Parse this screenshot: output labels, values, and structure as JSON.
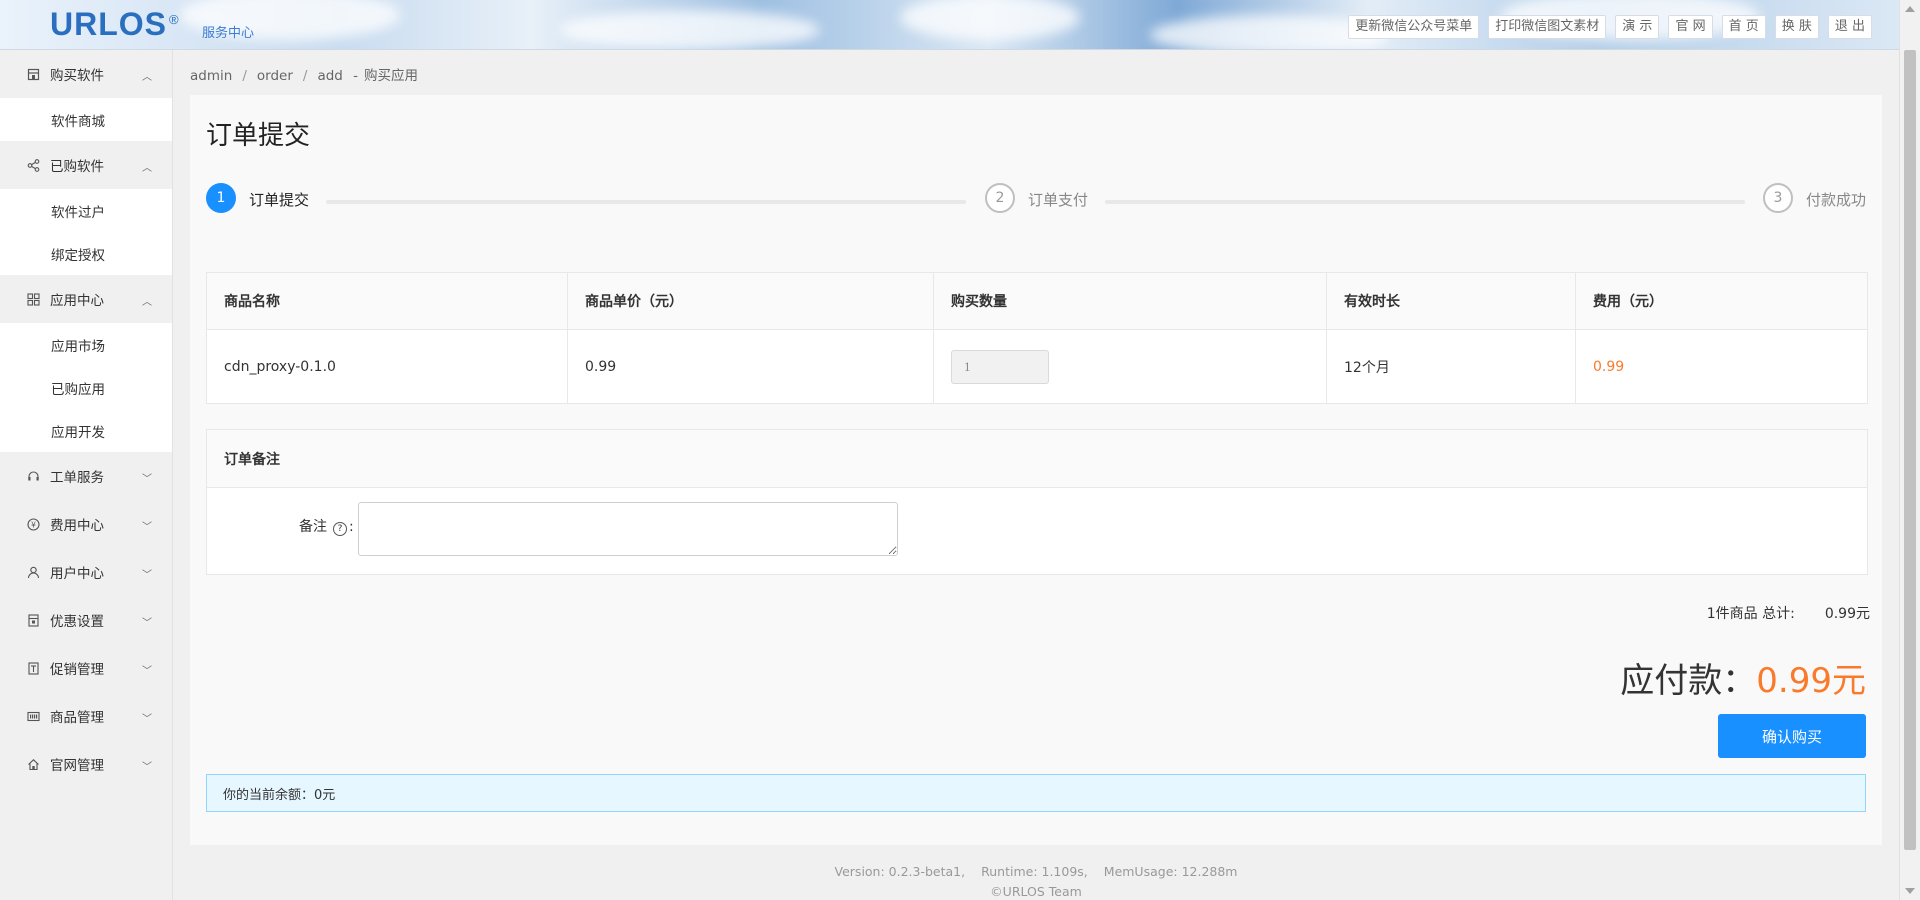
{
  "header": {
    "logo": "URLOS",
    "logo_mark": "®",
    "subtitle": "服务中心",
    "links": [
      "更新微信公众号菜单",
      "打印微信图文素材",
      "演 示",
      "官 网",
      "首 页",
      "换 肤",
      "退 出"
    ]
  },
  "sidebar": {
    "groups": [
      {
        "label": "购买软件",
        "icon": "shop-icon",
        "expanded": true,
        "items": [
          "软件商城"
        ]
      },
      {
        "label": "已购软件",
        "icon": "share-icon",
        "expanded": true,
        "items": [
          "软件过户",
          "绑定授权"
        ]
      },
      {
        "label": "应用中心",
        "icon": "grid-icon",
        "expanded": true,
        "items": [
          "应用市场",
          "已购应用",
          "应用开发"
        ]
      },
      {
        "label": "工单服务",
        "icon": "headset-icon",
        "expanded": false,
        "items": []
      },
      {
        "label": "费用中心",
        "icon": "yuan-icon",
        "expanded": false,
        "items": []
      },
      {
        "label": "用户中心",
        "icon": "user-icon",
        "expanded": false,
        "items": []
      },
      {
        "label": "优惠设置",
        "icon": "coupon-icon",
        "expanded": false,
        "items": []
      },
      {
        "label": "促销管理",
        "icon": "promo-icon",
        "expanded": false,
        "items": []
      },
      {
        "label": "商品管理",
        "icon": "barcode-icon",
        "expanded": false,
        "items": []
      },
      {
        "label": "官网管理",
        "icon": "home-icon",
        "expanded": false,
        "items": []
      }
    ]
  },
  "breadcrumb": {
    "parts": [
      "admin",
      "order",
      "add"
    ],
    "suffix": "购买应用"
  },
  "page": {
    "title": "订单提交"
  },
  "steps": [
    {
      "num": "1",
      "label": "订单提交",
      "active": true
    },
    {
      "num": "2",
      "label": "订单支付",
      "active": false
    },
    {
      "num": "3",
      "label": "付款成功",
      "active": false
    }
  ],
  "table": {
    "headers": [
      "商品名称",
      "商品单价（元）",
      "购买数量",
      "有效时长",
      "费用（元）"
    ],
    "row": {
      "name": "cdn_proxy-0.1.0",
      "price": "0.99",
      "qty": "1",
      "duration": "12个月",
      "cost": "0.99"
    }
  },
  "remark": {
    "title": "订单备注",
    "label": "备注",
    "help": "?",
    "colon": ":",
    "value": ""
  },
  "totals": {
    "subtotal_label": "1件商品 总计:",
    "subtotal_value": "0.99元",
    "due_label": "应付款：",
    "due_value": "0.99元"
  },
  "confirm_label": "确认购买",
  "balance_text": "你的当前余额：0元",
  "footer": {
    "version": "Version: 0.2.3-beta1,",
    "runtime": "Runtime: 1.109s,",
    "mem": "MemUsage: 12.288m",
    "copyright": "©URLOS Team"
  },
  "colors": {
    "primary": "#1890ff",
    "price": "#fa7a2c",
    "info_bg": "#e6f7ff"
  }
}
